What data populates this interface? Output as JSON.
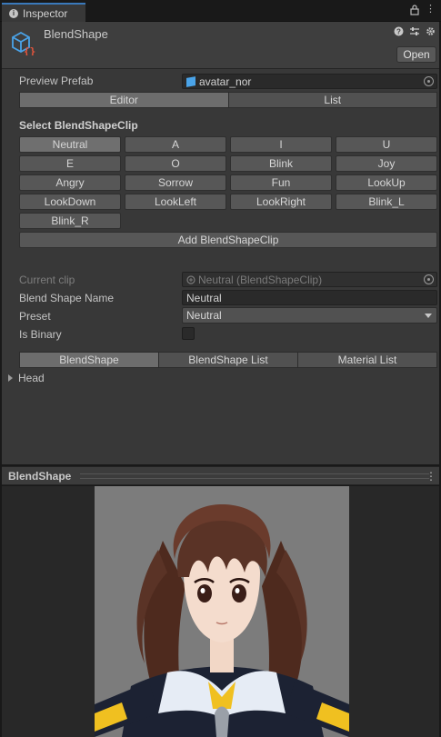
{
  "window": {
    "tab_label": "Inspector",
    "tab_icons": [
      "info-icon",
      "lock-icon",
      "kebab-menu-icon"
    ]
  },
  "component": {
    "title": "BlendShape",
    "icon": "blendshape-cube-icon",
    "header_icons": [
      "help-icon",
      "preset-sliders-icon",
      "settings-gear-icon"
    ],
    "open_label": "Open"
  },
  "preview_prefab": {
    "label": "Preview Prefab",
    "value": "avatar_nor",
    "icon": "prefab-icon"
  },
  "mode_tabs": [
    {
      "label": "Editor",
      "active": true
    },
    {
      "label": "List",
      "active": false
    }
  ],
  "clip_section": {
    "heading": "Select BlendShapeClip",
    "clips": [
      {
        "label": "Neutral",
        "active": true
      },
      {
        "label": "A",
        "active": false
      },
      {
        "label": "I",
        "active": false
      },
      {
        "label": "U",
        "active": false
      },
      {
        "label": "E",
        "active": false
      },
      {
        "label": "O",
        "active": false
      },
      {
        "label": "Blink",
        "active": false
      },
      {
        "label": "Joy",
        "active": false
      },
      {
        "label": "Angry",
        "active": false
      },
      {
        "label": "Sorrow",
        "active": false
      },
      {
        "label": "Fun",
        "active": false
      },
      {
        "label": "LookUp",
        "active": false
      },
      {
        "label": "LookDown",
        "active": false
      },
      {
        "label": "LookLeft",
        "active": false
      },
      {
        "label": "LookRight",
        "active": false
      },
      {
        "label": "Blink_L",
        "active": false
      },
      {
        "label": "Blink_R",
        "active": false
      }
    ],
    "add_label": "Add BlendShapeClip"
  },
  "clip_properties": {
    "current_clip_label": "Current clip",
    "current_clip_value": "Neutral (BlendShapeClip)",
    "name_label": "Blend Shape Name",
    "name_value": "Neutral",
    "preset_label": "Preset",
    "preset_value": "Neutral",
    "is_binary_label": "Is Binary",
    "is_binary_checked": false
  },
  "sub_tabs": [
    {
      "label": "BlendShape",
      "active": true
    },
    {
      "label": "BlendShape List",
      "active": false
    },
    {
      "label": "Material List",
      "active": false
    }
  ],
  "foldout": {
    "label": "Head",
    "expanded": false
  },
  "preview": {
    "title": "BlendShape",
    "menu_icon": "kebab-menu-icon",
    "background": "#7c7c7c"
  },
  "colors": {
    "accent": "#3a79bb",
    "panel": "#383838",
    "hair": "#5a3326",
    "skin": "#f4dccd",
    "uniform": "#1c2233",
    "ribbon": "#f0c020"
  }
}
